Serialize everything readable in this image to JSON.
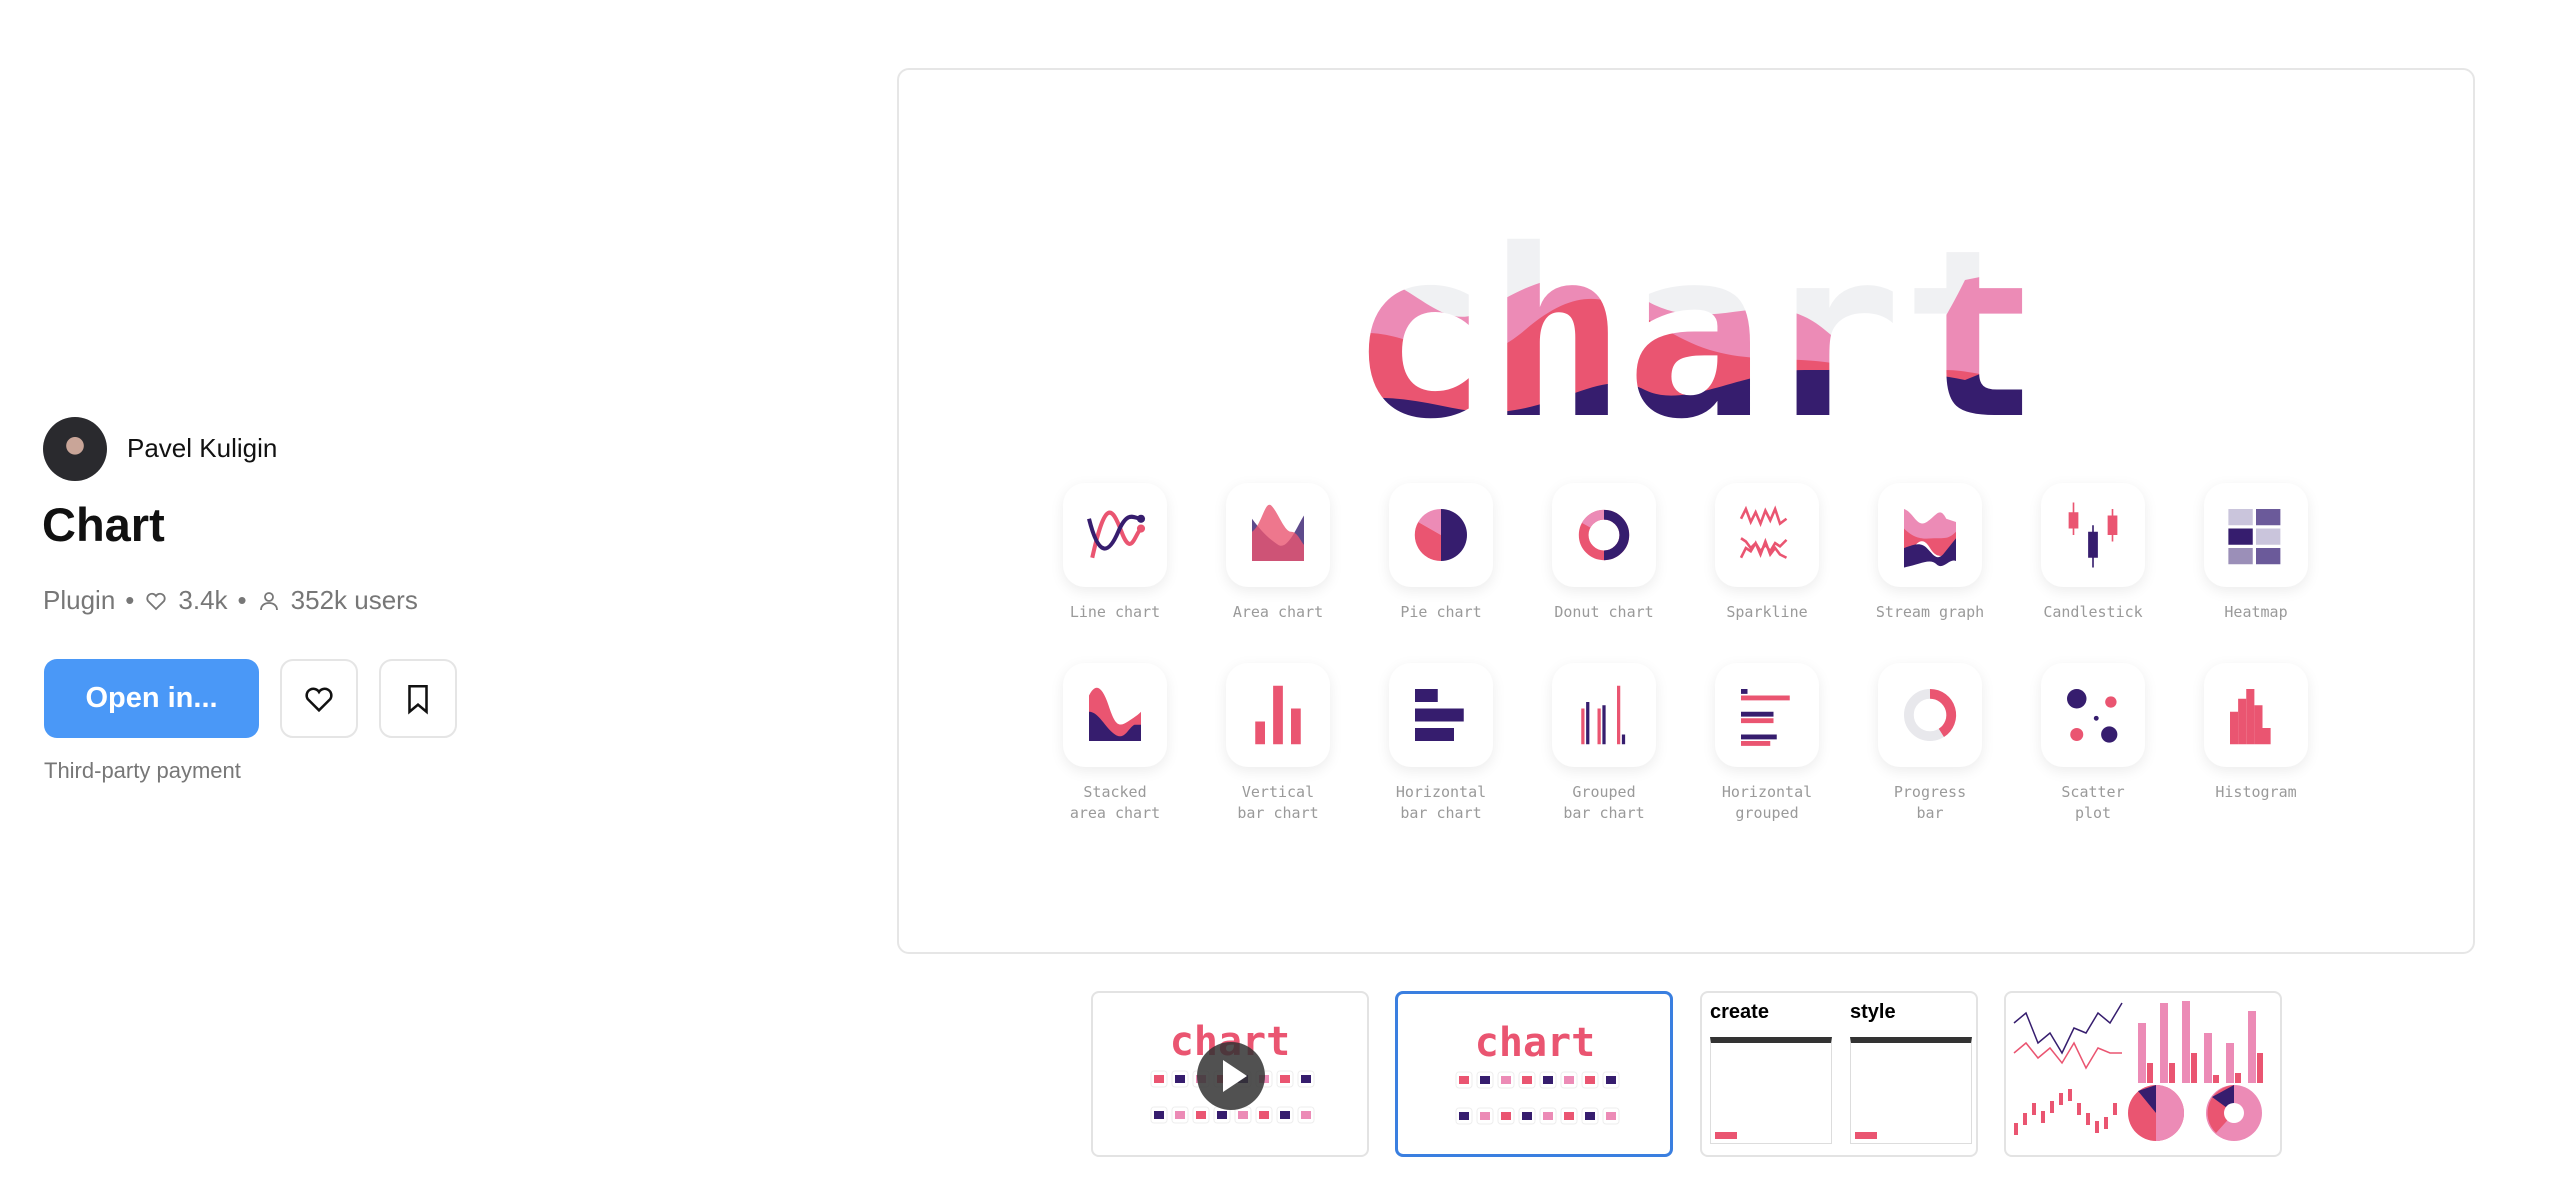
{
  "author": {
    "name": "Pavel Kuligin"
  },
  "title": "Chart",
  "meta": {
    "type": "Plugin",
    "likes": "3.4k",
    "users": "352k users"
  },
  "actions": {
    "open_label": "Open in...",
    "like_icon": "heart-icon",
    "save_icon": "bookmark-icon"
  },
  "payment_note": "Third-party payment",
  "hero": {
    "word": "chart",
    "colors": {
      "pink": "#ec8bb6",
      "red": "#ea5571",
      "purple": "#361d6e",
      "light": "#f0f1f3"
    },
    "charts": [
      {
        "label": "Line chart",
        "icon": "line-chart-icon"
      },
      {
        "label": "Area chart",
        "icon": "area-chart-icon"
      },
      {
        "label": "Pie chart",
        "icon": "pie-chart-icon"
      },
      {
        "label": "Donut chart",
        "icon": "donut-chart-icon"
      },
      {
        "label": "Sparkline",
        "icon": "sparkline-icon"
      },
      {
        "label": "Stream graph",
        "icon": "stream-graph-icon"
      },
      {
        "label": "Candlestick",
        "icon": "candlestick-icon"
      },
      {
        "label": "Heatmap",
        "icon": "heatmap-icon"
      },
      {
        "label": "Stacked\narea chart",
        "icon": "stacked-area-icon"
      },
      {
        "label": "Vertical\nbar chart",
        "icon": "vertical-bar-icon"
      },
      {
        "label": "Horizontal\nbar chart",
        "icon": "horizontal-bar-icon"
      },
      {
        "label": "Grouped\nbar chart",
        "icon": "grouped-bar-icon"
      },
      {
        "label": "Horizontal\ngrouped",
        "icon": "horizontal-grouped-icon"
      },
      {
        "label": "Progress\nbar",
        "icon": "progress-bar-icon"
      },
      {
        "label": "Scatter\nplot",
        "icon": "scatter-plot-icon"
      },
      {
        "label": "Histogram",
        "icon": "histogram-icon"
      }
    ]
  },
  "thumbnails": {
    "selected_index": 1,
    "items": [
      {
        "word": "chart",
        "play_icon": "play-icon"
      },
      {
        "word": "chart"
      },
      {
        "left_heading": "create",
        "right_heading": "style"
      },
      {}
    ]
  }
}
